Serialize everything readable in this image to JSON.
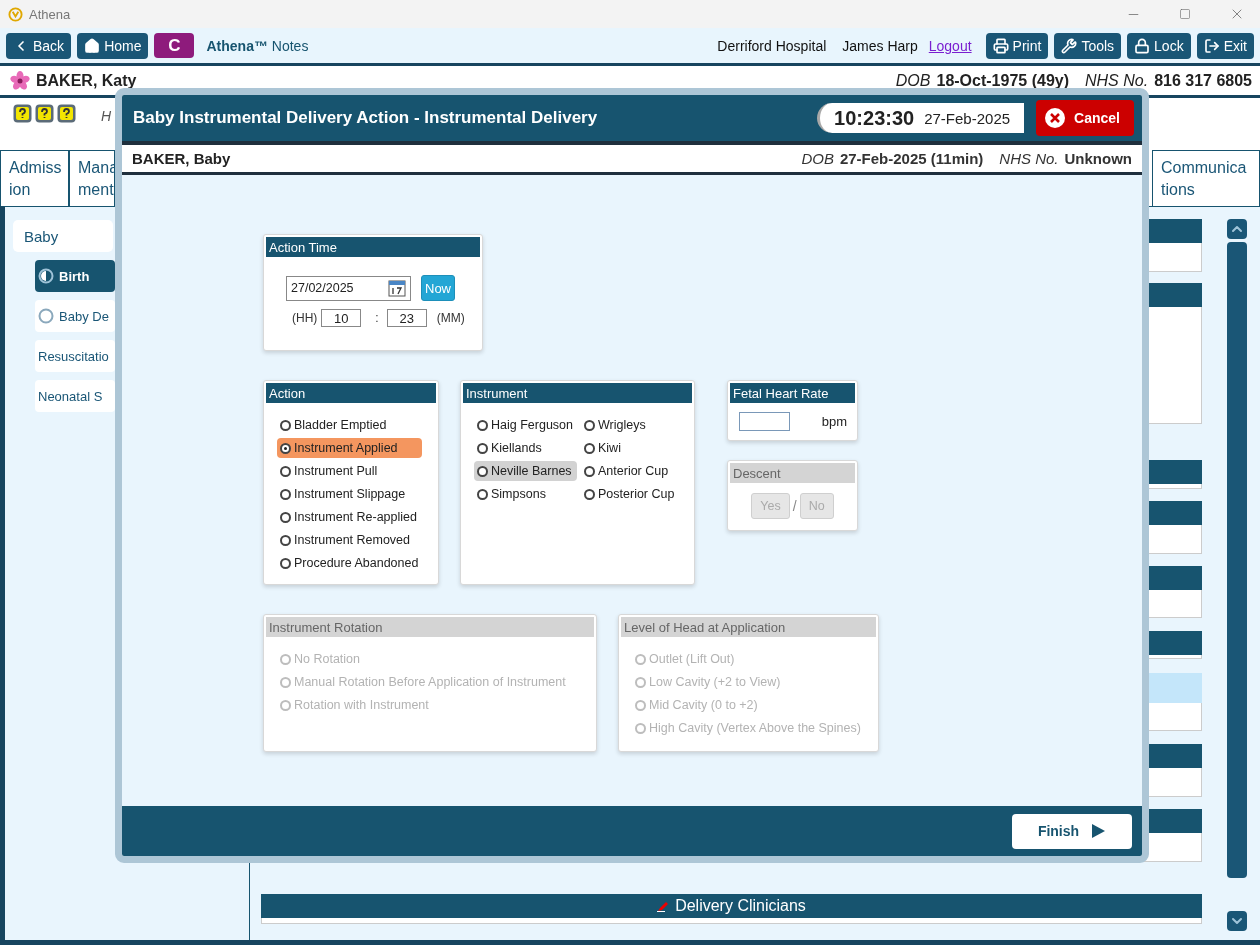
{
  "window": {
    "title": "Athena"
  },
  "toolbar": {
    "left_buttons": [
      {
        "label": "Back",
        "kind": "back"
      },
      {
        "label": "Home",
        "kind": "home"
      }
    ],
    "app_badge": "C",
    "app_name": "Athena™",
    "app_subtitle": "Notes",
    "hospital": "Derriford Hospital",
    "user": "James Harp",
    "logout": "Logout",
    "right_buttons": [
      {
        "label": "Print",
        "kind": "print"
      },
      {
        "label": "Tools",
        "kind": "tools"
      },
      {
        "label": "Lock",
        "kind": "lock"
      },
      {
        "label": "Exit",
        "kind": "exit"
      }
    ]
  },
  "patient": {
    "name": "BAKER, Katy",
    "dob_label": "DOB",
    "dob": "18-Oct-1975 (49y)",
    "nhs_label": "NHS No.",
    "nhs": "816 317 6805"
  },
  "alert_text": "H",
  "tabs": [
    {
      "lines": [
        "Admiss",
        "ion"
      ]
    },
    {
      "lines": [
        "Mana",
        "ment"
      ]
    },
    {
      "lines": [
        "Communica",
        "tions"
      ]
    }
  ],
  "sidebar": {
    "group": "Baby",
    "items": [
      {
        "kind": "partial",
        "label": "Birth",
        "selected": true
      },
      {
        "kind": "empty",
        "label": "Baby De",
        "selected": false
      },
      {
        "kind": "plain",
        "label": "Resuscitatio",
        "selected": false
      },
      {
        "kind": "plain",
        "label": "Neonatal S",
        "selected": false
      }
    ]
  },
  "bottom_panel": {
    "title": "Delivery Clinicians"
  },
  "modal": {
    "title": "Baby Instrumental Delivery Action - Instrumental Delivery",
    "clock_time": "10:23:30",
    "clock_date": "27-Feb-2025",
    "cancel": "Cancel",
    "baby": {
      "name": "BAKER, Baby",
      "dob_label": "DOB",
      "dob": "27-Feb-2025 (11min)",
      "nhs_label": "NHS No.",
      "nhs": "Unknown"
    },
    "action_time": {
      "title": "Action Time",
      "date": "27/02/2025",
      "now": "Now",
      "hh_label": "(HH)",
      "hour": "10",
      "separator": ":",
      "minute": "23",
      "mm_label": "(MM)"
    },
    "action": {
      "title": "Action",
      "options": [
        {
          "label": "Bladder Emptied",
          "selected": false
        },
        {
          "label": "Instrument Applied",
          "selected": true
        },
        {
          "label": "Instrument Pull",
          "selected": false
        },
        {
          "label": "Instrument Slippage",
          "selected": false
        },
        {
          "label": "Instrument Re-applied",
          "selected": false
        },
        {
          "label": "Instrument Removed",
          "selected": false
        },
        {
          "label": "Procedure Abandoned",
          "selected": false
        }
      ]
    },
    "instrument": {
      "title": "Instrument",
      "options": [
        {
          "label": "Haig Ferguson",
          "selected": false,
          "hovered": false
        },
        {
          "label": "Wrigleys",
          "selected": false,
          "hovered": false
        },
        {
          "label": "Kiellands",
          "selected": false,
          "hovered": false
        },
        {
          "label": "Kiwi",
          "selected": false,
          "hovered": false
        },
        {
          "label": "Neville Barnes",
          "selected": false,
          "hovered": true
        },
        {
          "label": "Anterior Cup",
          "selected": false,
          "hovered": false
        },
        {
          "label": "Simpsons",
          "selected": false,
          "hovered": false
        },
        {
          "label": "Posterior Cup",
          "selected": false,
          "hovered": false
        }
      ]
    },
    "fetal_heart_rate": {
      "title": "Fetal Heart Rate",
      "unit": "bpm"
    },
    "descent": {
      "title": "Descent",
      "disabled": true,
      "yes": "Yes",
      "separator": "/",
      "no": "No"
    },
    "instrument_rotation": {
      "title": "Instrument Rotation",
      "disabled": true,
      "options": [
        {
          "label": "No Rotation",
          "selected": false
        },
        {
          "label": "Manual Rotation Before Application of Instrument",
          "selected": false
        },
        {
          "label": "Rotation with Instrument",
          "selected": false
        }
      ]
    },
    "level_of_head": {
      "title": "Level of Head at Application",
      "disabled": true,
      "options": [
        {
          "label": "Outlet (Lift Out)",
          "selected": false
        },
        {
          "label": "Low Cavity (+2 to View)",
          "selected": false
        },
        {
          "label": "Mid Cavity (0 to +2)",
          "selected": false
        },
        {
          "label": "High Cavity (Vertex Above the Spines)",
          "selected": false
        }
      ]
    },
    "finish": "Finish"
  }
}
